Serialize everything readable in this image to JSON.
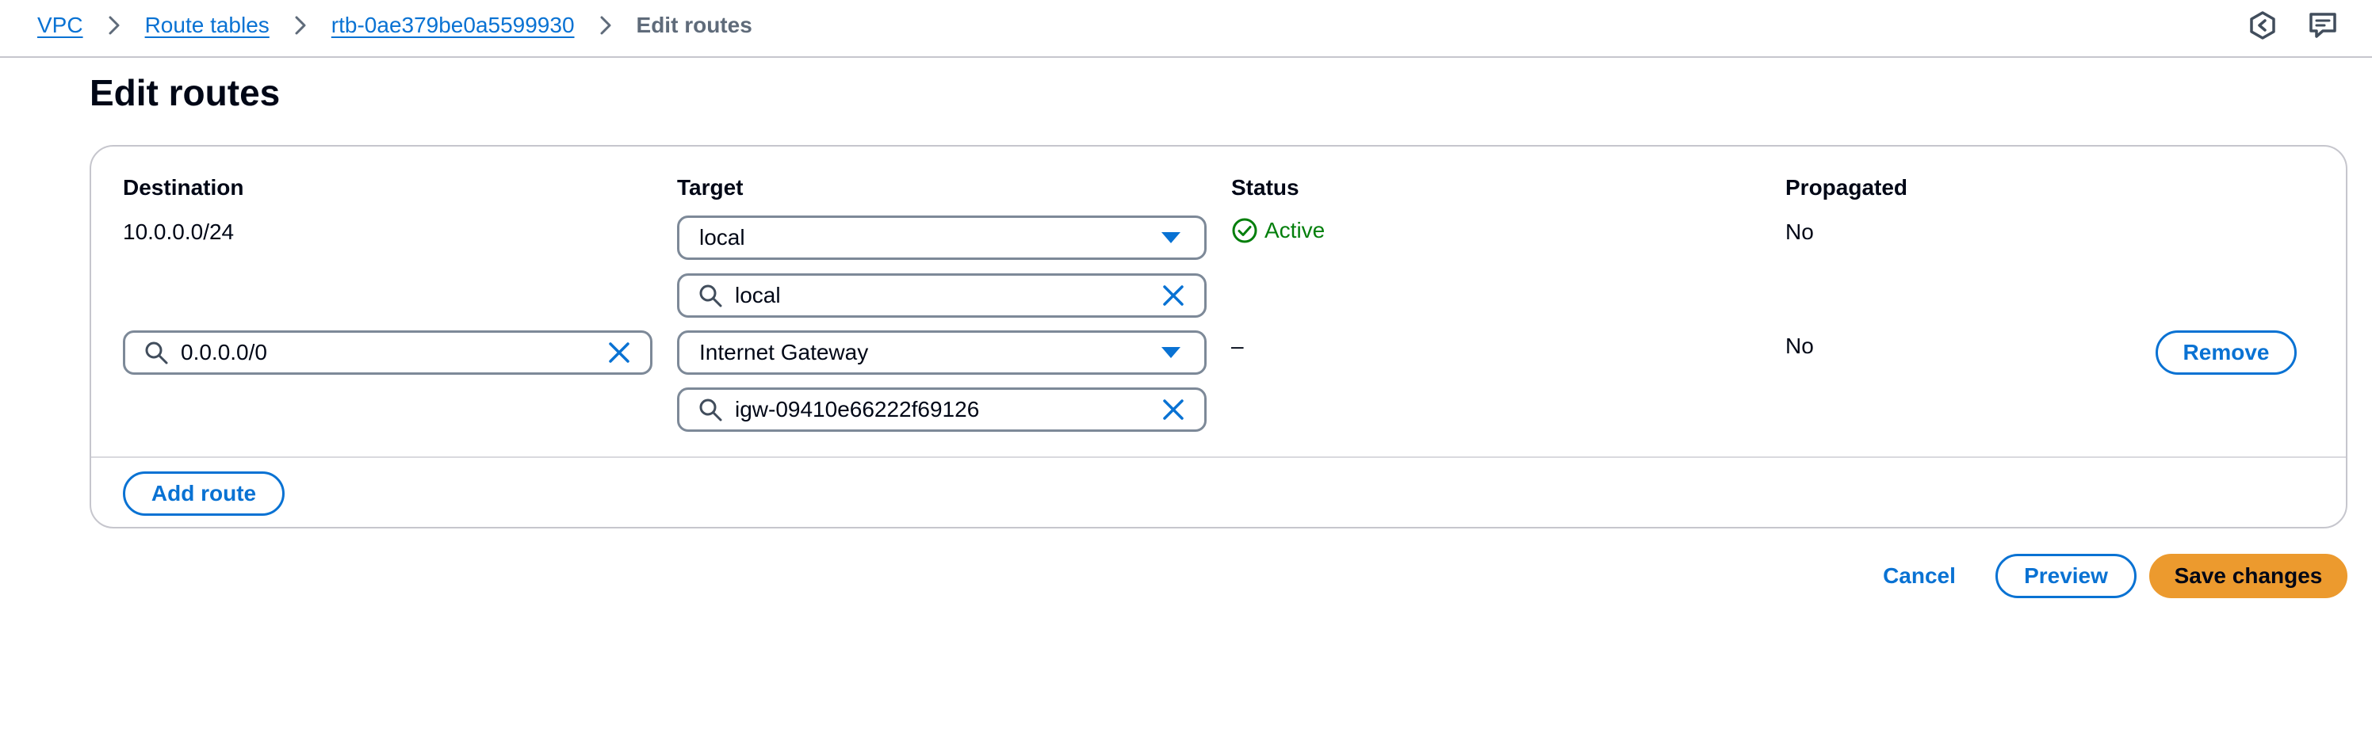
{
  "breadcrumb": {
    "items": [
      "VPC",
      "Route tables",
      "rtb-0ae379be0a5599930"
    ],
    "current": "Edit routes"
  },
  "page": {
    "title": "Edit routes"
  },
  "table": {
    "headers": {
      "destination": "Destination",
      "target": "Target",
      "status": "Status",
      "propagated": "Propagated"
    },
    "rows": [
      {
        "destination": "10.0.0.0/24",
        "target_type": "local",
        "target_value": "local",
        "status": "Active",
        "propagated": "No"
      },
      {
        "destination": "0.0.0.0/0",
        "target_type": "Internet Gateway",
        "target_value": "igw-09410e66222f69126",
        "status": "–",
        "propagated": "No",
        "remove_label": "Remove"
      }
    ]
  },
  "actions": {
    "add_route": "Add route",
    "cancel": "Cancel",
    "preview": "Preview",
    "save": "Save changes"
  },
  "colors": {
    "link": "#0972d3",
    "success": "#037f0c",
    "primary_button": "#ec9a2e"
  }
}
